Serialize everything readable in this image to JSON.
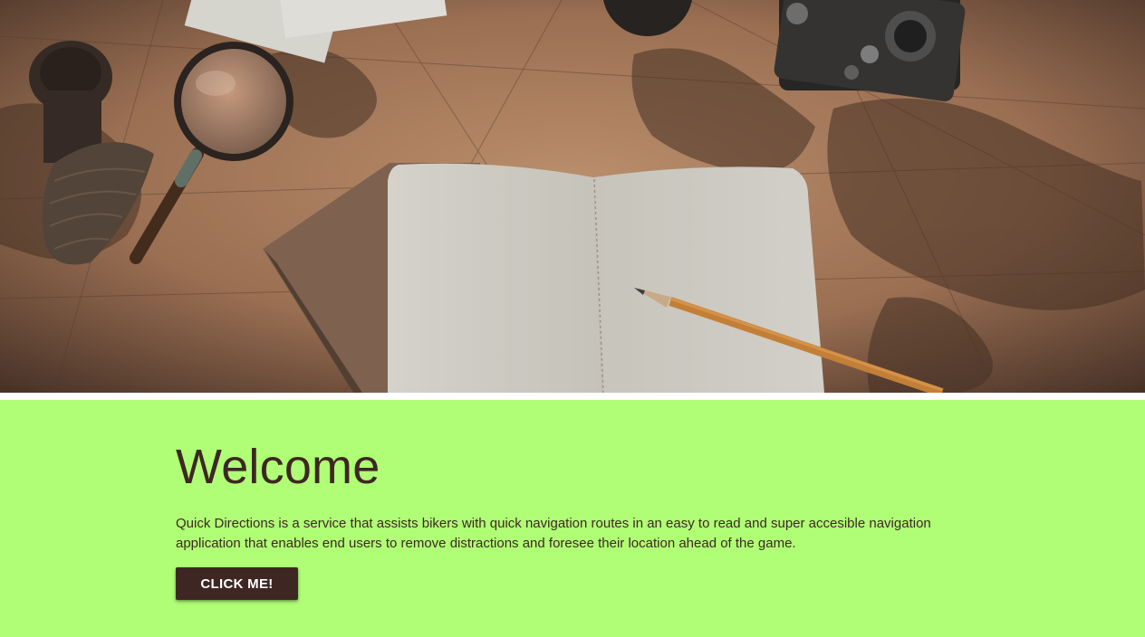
{
  "hero": {
    "image_description_icon": "travel-map-photo"
  },
  "welcome": {
    "heading": "Welcome",
    "body": "Quick Directions is a service that assists bikers with quick navigation routes in an easy to read and super accesible navigation application that enables end users to remove distractions and foresee their location ahead of the game.",
    "button_label": "CLICK ME!"
  },
  "colors": {
    "section_bg": "#b0fe76",
    "text": "#3e2723",
    "button_bg": "#3e2723",
    "button_text": "#ffffff"
  }
}
